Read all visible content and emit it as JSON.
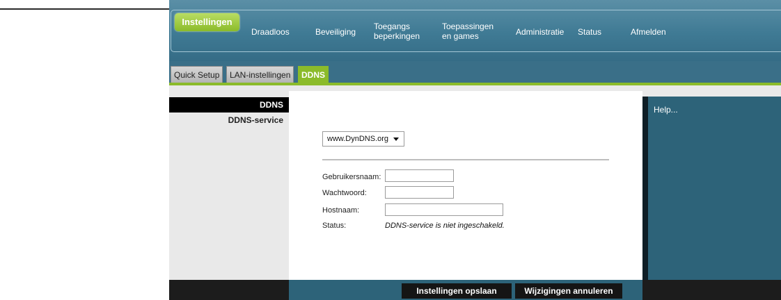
{
  "nav": {
    "active": "Instellingen",
    "items": [
      "Draadloos",
      "Beveiliging",
      "Toegangs\nbeperkingen",
      "Toepassingen\nen games",
      "Administratie",
      "Status",
      "Afmelden"
    ],
    "item1": "Draadloos",
    "item2": "Beveiliging",
    "item3_line1": "Toegangs",
    "item3_line2": "beperkingen",
    "item4_line1": "Toepassingen",
    "item4_line2": "en games",
    "item5": "Administratie",
    "item6": "Status",
    "item7": "Afmelden"
  },
  "subtabs": {
    "tab1": "Quick Setup",
    "tab2": "LAN-instellingen",
    "tab3": "DDNS"
  },
  "sidebar": {
    "heading": "DDNS",
    "item": "DDNS-service"
  },
  "form": {
    "provider_selected": "www.DynDNS.org",
    "username_label": "Gebruikersnaam:",
    "password_label": "Wachtwoord:",
    "hostname_label": "Hostnaam:",
    "status_label": "Status:",
    "status_value": "DDNS-service is niet ingeschakeld."
  },
  "help": {
    "label": "Help..."
  },
  "footer": {
    "save": "Instellingen opslaan",
    "cancel": "Wijzigingen annuleren"
  },
  "colors": {
    "header": "#3f7a94",
    "accent_green": "#8bbb2a",
    "help_panel": "#2d6379"
  }
}
